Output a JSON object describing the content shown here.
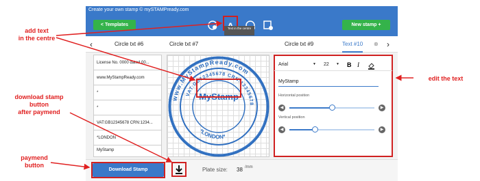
{
  "window": {
    "title": "Create your own stamp © mySTAMPready.com"
  },
  "toolbar": {
    "templates_label": "< Templates",
    "new_stamp_label": "New stamp +",
    "tooltip": "Text in the centre"
  },
  "tabs": {
    "prev_icon": "chevron-left-icon",
    "items": [
      "Circle txt #6",
      "Circle txt #7",
      "Circle txt #9",
      "Text #10"
    ],
    "active": "Text #10"
  },
  "left_list": {
    "items": [
      "License No. 0000 dated 00...",
      "www.MyStampReady.com",
      "*",
      "*",
      "VAT:GB12345678 CRN:1234...",
      "*LONDON",
      "MyStamp"
    ]
  },
  "stamp": {
    "center_text": "MyStamp",
    "outer_text": "www.MyStampReady.com",
    "inner_text": "VAT:GB12345678 CRN:12345678",
    "bottom_text": "*LONDON*",
    "color": "#2f6fc0"
  },
  "editor": {
    "font": "Arial",
    "size": "22",
    "bold": "B",
    "italic": "I",
    "text_value": "MyStamp",
    "horizontal_label": "Horizontal position",
    "horizontal_value": 0.5,
    "vertical_label": "Vertical position",
    "vertical_value": 0.3
  },
  "bottom": {
    "download_label": "Download Stamp",
    "plate_label": "Plate size:",
    "plate_value": "38",
    "plate_unit": "/mm"
  },
  "annotations": {
    "add_text": "add text\nin the centre",
    "download": "download stamp\nbutton\nafter paymend",
    "payment": "paymend\nbutton",
    "edit": "edit the text"
  },
  "colors": {
    "accent": "#3a79c9",
    "green": "#34b34a",
    "annotation": "#e02020"
  }
}
